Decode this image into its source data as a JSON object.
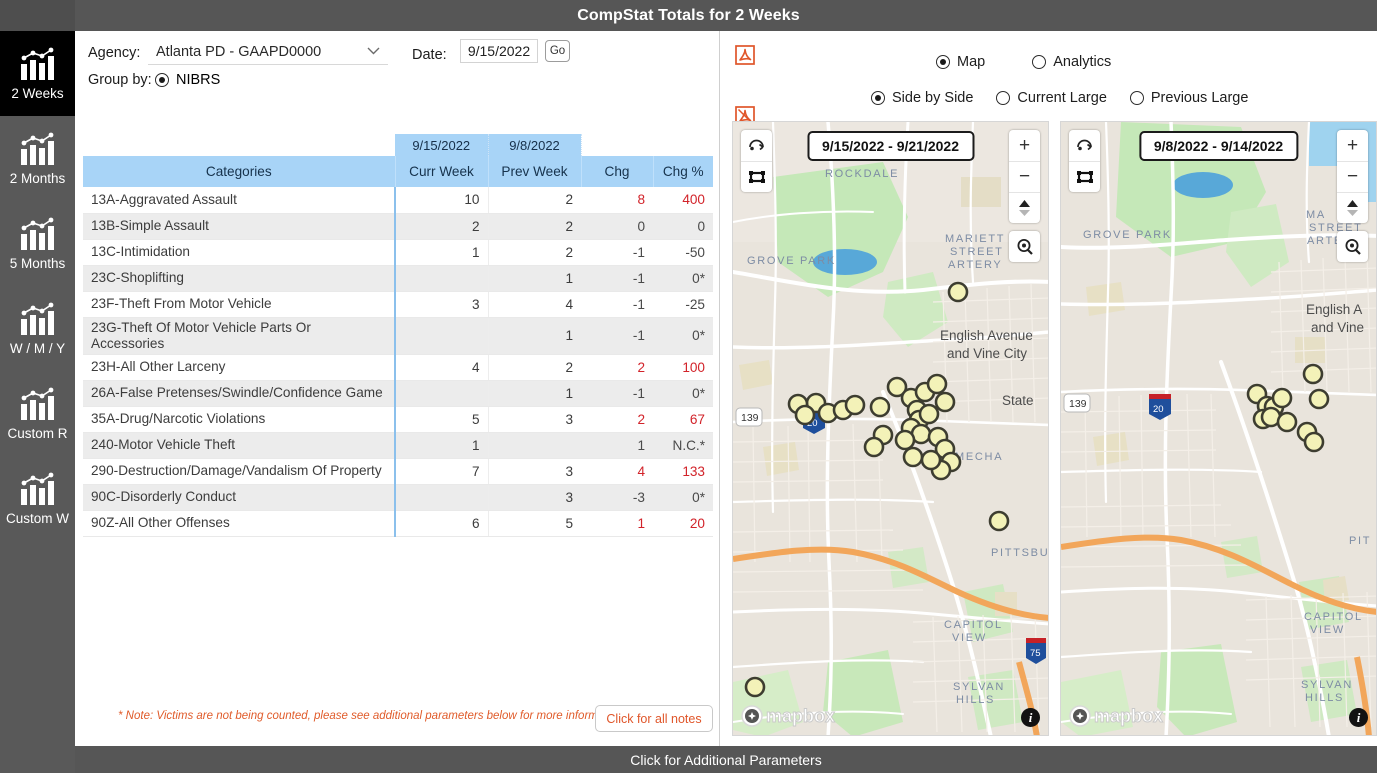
{
  "window": {
    "title": "CompStat Totals for 2 Weeks"
  },
  "sidebar": {
    "items": [
      {
        "label": "2 Weeks",
        "icon": "bar-chart-icon",
        "active": true
      },
      {
        "label": "2 Months",
        "icon": "bar-chart-icon",
        "active": false
      },
      {
        "label": "5 Months",
        "icon": "bar-chart-icon",
        "active": false
      },
      {
        "label": "W / M / Y",
        "icon": "bar-chart-icon",
        "active": false
      },
      {
        "label": "Custom R",
        "icon": "bar-chart-icon",
        "active": false
      },
      {
        "label": "Custom W",
        "icon": "bar-chart-icon",
        "active": false
      }
    ]
  },
  "filters": {
    "agency_label": "Agency:",
    "agency_value": "Atlanta PD - GAAPD0000",
    "date_label": "Date:",
    "date_value": "9/15/2022",
    "go_label": "Go",
    "groupby_label": "Group by:",
    "groupby_option": "NIBRS",
    "groupby_selected": true
  },
  "table_tools": {
    "export_icon": "export-list-icon",
    "pdf_icon": "pdf-icon"
  },
  "table": {
    "date_headers": {
      "curr": "9/15/2022",
      "prev": "9/8/2022"
    },
    "columns": [
      "Categories",
      "Curr Week",
      "Prev Week",
      "Chg",
      "Chg %"
    ],
    "rows": [
      {
        "category": "13A-Aggravated Assault",
        "curr": "10",
        "prev": "2",
        "chg": "8",
        "pct": "400",
        "chg_color": "up",
        "pct_color": "up"
      },
      {
        "category": "13B-Simple Assault",
        "curr": "2",
        "prev": "2",
        "chg": "0",
        "pct": "0",
        "chg_color": "flat",
        "pct_color": "flat"
      },
      {
        "category": "13C-Intimidation",
        "curr": "1",
        "prev": "2",
        "chg": "-1",
        "pct": "-50",
        "chg_color": "flat",
        "pct_color": "flat"
      },
      {
        "category": "23C-Shoplifting",
        "curr": "",
        "prev": "1",
        "chg": "-1",
        "pct": "0*",
        "chg_color": "flat",
        "pct_color": "flat"
      },
      {
        "category": "23F-Theft From Motor Vehicle",
        "curr": "3",
        "prev": "4",
        "chg": "-1",
        "pct": "-25",
        "chg_color": "flat",
        "pct_color": "flat"
      },
      {
        "category": "23G-Theft Of Motor Vehicle Parts Or Accessories",
        "curr": "",
        "prev": "1",
        "chg": "-1",
        "pct": "0*",
        "chg_color": "flat",
        "pct_color": "flat"
      },
      {
        "category": "23H-All Other Larceny",
        "curr": "4",
        "prev": "2",
        "chg": "2",
        "pct": "100",
        "chg_color": "up",
        "pct_color": "up"
      },
      {
        "category": "26A-False Pretenses/Swindle/Confidence Game",
        "curr": "",
        "prev": "1",
        "chg": "-1",
        "pct": "0*",
        "chg_color": "flat",
        "pct_color": "flat"
      },
      {
        "category": "35A-Drug/Narcotic Violations",
        "curr": "5",
        "prev": "3",
        "chg": "2",
        "pct": "67",
        "chg_color": "up",
        "pct_color": "up"
      },
      {
        "category": "240-Motor Vehicle Theft",
        "curr": "1",
        "prev": "",
        "chg": "1",
        "pct": "N.C.*",
        "chg_color": "flat",
        "pct_color": "flat"
      },
      {
        "category": "290-Destruction/Damage/Vandalism Of Property",
        "curr": "7",
        "prev": "3",
        "chg": "4",
        "pct": "133",
        "chg_color": "up",
        "pct_color": "up"
      },
      {
        "category": "90C-Disorderly Conduct",
        "curr": "",
        "prev": "3",
        "chg": "-3",
        "pct": "0*",
        "chg_color": "flat",
        "pct_color": "flat"
      },
      {
        "category": "90Z-All Other Offenses",
        "curr": "6",
        "prev": "5",
        "chg": "1",
        "pct": "20",
        "chg_color": "up",
        "pct_color": "up"
      }
    ]
  },
  "notes": {
    "text": "* Note: Victims are not being counted, please see additional parameters below for more information.",
    "button_label": "Click for all notes"
  },
  "view_controls": {
    "pdf_icon_top": "pdf-icon",
    "pdf_icon_bottom": "pdf-export-icon",
    "mode_options": [
      {
        "label": "Map",
        "selected": true
      },
      {
        "label": "Analytics",
        "selected": false
      }
    ],
    "layout_options": [
      {
        "label": "Side by Side",
        "selected": true
      },
      {
        "label": "Current Large",
        "selected": false
      },
      {
        "label": "Previous Large",
        "selected": false
      }
    ]
  },
  "maps": [
    {
      "date_range": "9/15/2022 - 9/21/2022",
      "attribution": "mapbox",
      "labels": [
        "ROCKDALE",
        "GROVE PARK",
        "MARIETTA STREET ARTERY",
        "English Avenue and Vine City",
        "State",
        "MECHA",
        "PITTSBUR",
        "CAPITOL VIEW",
        "SYLVAN HILLS"
      ],
      "shields": [
        "139",
        "20",
        "75"
      ],
      "marker_count": 28
    },
    {
      "date_range": "9/8/2022 - 9/14/2022",
      "attribution": "mapbox",
      "labels": [
        "GROVE PARK",
        "MA STREET A",
        "English Av and Vine",
        "PIT",
        "CAPITOL VIEW",
        "SYLVAN HILLS"
      ],
      "shields": [
        "139",
        "20"
      ],
      "marker_count": 11
    }
  ],
  "footer": {
    "label": "Click for Additional Parameters"
  },
  "colors": {
    "title_bar": "#565656",
    "rail": "#595959",
    "rail_active": "#000000",
    "header_blue": "#a8d4f7",
    "accent_red": "#d2232a",
    "note_orange": "#e05b2a",
    "marker_fill": "#f2f2b4",
    "marker_stroke": "#3a3a2e"
  }
}
